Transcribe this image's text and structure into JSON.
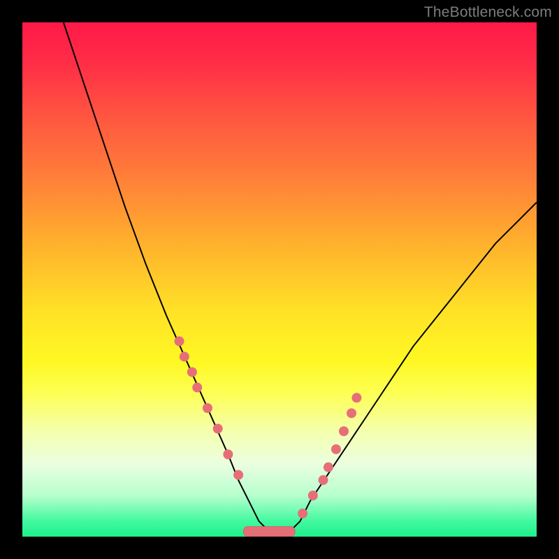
{
  "watermark": "TheBottleneck.com",
  "chart_data": {
    "type": "line",
    "title": "",
    "xlabel": "",
    "ylabel": "",
    "xlim": [
      0,
      100
    ],
    "ylim": [
      0,
      100
    ],
    "grid": false,
    "legend": false,
    "background_gradient": {
      "direction": "vertical",
      "stops": [
        {
          "pos": 0,
          "color": "#ff1947"
        },
        {
          "pos": 20,
          "color": "#ff5c3f"
        },
        {
          "pos": 42,
          "color": "#ffad2e"
        },
        {
          "pos": 66,
          "color": "#fff824"
        },
        {
          "pos": 86,
          "color": "#eaffe0"
        },
        {
          "pos": 100,
          "color": "#1ef08b"
        }
      ]
    },
    "series": [
      {
        "name": "bottleneck-curve",
        "x": [
          8,
          12,
          16,
          20,
          24,
          28,
          32,
          36,
          40,
          42,
          44,
          46,
          48,
          50,
          52,
          54,
          56,
          60,
          64,
          68,
          72,
          76,
          80,
          84,
          88,
          92,
          96,
          100
        ],
        "y": [
          100,
          88,
          76,
          64,
          53,
          43,
          34,
          25,
          16,
          11,
          7,
          3,
          1,
          1,
          1,
          3,
          7,
          13,
          19,
          25,
          31,
          37,
          42,
          47,
          52,
          57,
          61,
          65
        ]
      }
    ],
    "markers": {
      "name": "sample-points",
      "x": [
        30.5,
        31.5,
        33.0,
        34.0,
        36.0,
        38.0,
        40.0,
        42.0,
        54.5,
        56.5,
        58.5,
        59.5,
        61.0,
        62.5,
        64.0,
        65.0
      ],
      "y": [
        38.0,
        35.0,
        32.0,
        29.0,
        25.0,
        21.0,
        16.0,
        12.0,
        4.5,
        8.0,
        11.0,
        13.5,
        17.0,
        20.5,
        24.0,
        27.0
      ]
    },
    "valley_bar": {
      "x_start": 43,
      "x_end": 53,
      "y": 1
    }
  }
}
